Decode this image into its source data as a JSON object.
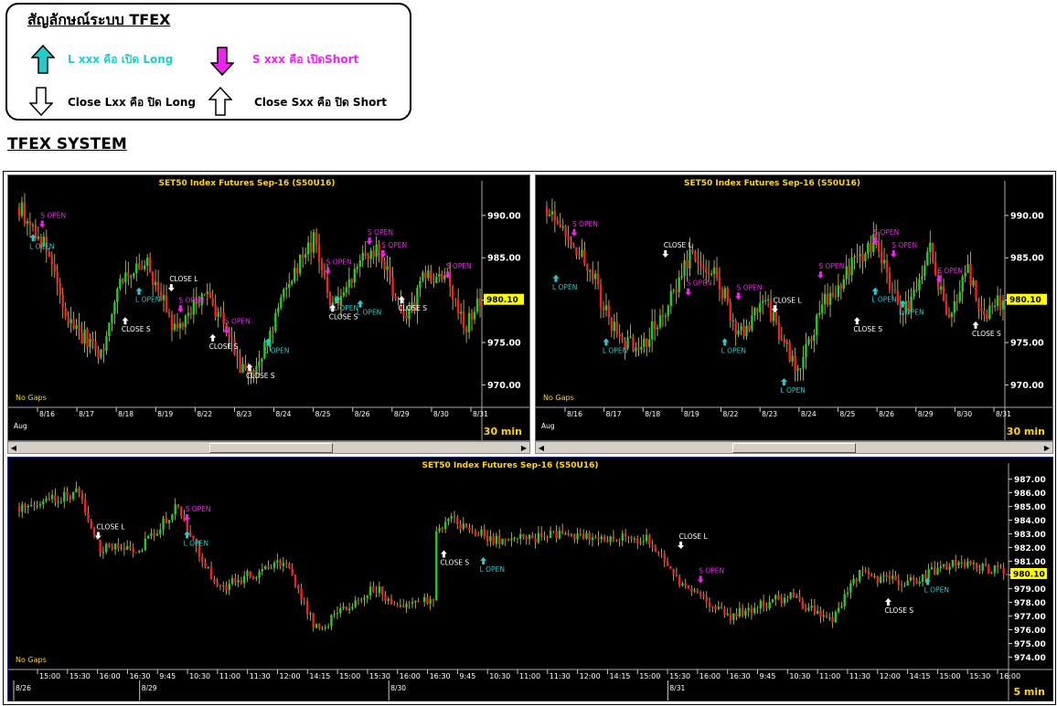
{
  "legend": {
    "title": "สัญลักษณ์ระบบ TFEX",
    "long_open": "L xxx คือ เปิด Long",
    "short_open": "S xxx คือ เปิดShort",
    "close_long": "Close Lxx คือ ปิด Long",
    "close_short": "Close Sxx คือ ปิด Short"
  },
  "system_title": "TFEX SYSTEM",
  "colors": {
    "up": "#22cc22",
    "down": "#ee2222",
    "long": "#22cccc",
    "short": "#ee22ee",
    "close": "#ffffff",
    "title": "#ffd700",
    "price_box": "#ffff00"
  },
  "charts": [
    {
      "title": "SET50  Index  Futures  Sep-16  (S50U16)",
      "timeframe": "30  min",
      "no_gaps": "No  Gaps",
      "last_price": "980.10",
      "y_ticks": [
        "990.00",
        "985.00",
        "980.00",
        "975.00",
        "970.00"
      ],
      "x_ticks": [
        "8/16",
        "8/17",
        "8/18",
        "8/19",
        "8/22",
        "8/23",
        "8/24",
        "8/25",
        "8/26",
        "8/29",
        "8/30",
        "8/31"
      ],
      "x_sub": "Aug",
      "ylim": [
        968,
        993
      ],
      "signals": [
        {
          "label": "S  OPEN",
          "type": "short"
        },
        {
          "label": "L  OPEN",
          "type": "long"
        },
        {
          "label": "CLOSE  L",
          "type": "close_long"
        },
        {
          "label": "L  OPEN",
          "type": "long"
        },
        {
          "label": "CLOSE  S",
          "type": "close_short"
        },
        {
          "label": "S  OPEN",
          "type": "short"
        },
        {
          "label": "CLOSE  S",
          "type": "close_short"
        },
        {
          "label": "S  OPEN",
          "type": "short"
        },
        {
          "label": "CLOSE  S",
          "type": "close_short"
        },
        {
          "label": "L  OPEN",
          "type": "long"
        },
        {
          "label": "S  OPEN",
          "type": "short"
        },
        {
          "label": "L  OPEN",
          "type": "long"
        },
        {
          "label": "CLOSE  S",
          "type": "close_short"
        },
        {
          "label": "S  OPEN",
          "type": "short"
        },
        {
          "label": "S  OPEN",
          "type": "short"
        },
        {
          "label": "L  OPEN",
          "type": "long"
        },
        {
          "label": "CLOSE  S",
          "type": "close_short"
        },
        {
          "label": "S  OPEN",
          "type": "short"
        }
      ]
    },
    {
      "title": "SET50  Index  Futures  Sep-16  (S50U16)",
      "timeframe": "30  min",
      "no_gaps": "No  Gaps",
      "last_price": "980.10",
      "y_ticks": [
        "990.00",
        "985.00",
        "980.00",
        "975.00",
        "970.00"
      ],
      "x_ticks": [
        "8/16",
        "8/17",
        "8/18",
        "8/19",
        "8/22",
        "8/23",
        "8/24",
        "8/25",
        "8/26",
        "8/29",
        "8/30",
        "8/31"
      ],
      "x_sub": "Aug",
      "ylim": [
        968,
        993
      ],
      "signals": [
        {
          "label": "S  OPEN",
          "type": "short"
        },
        {
          "label": "L  OPEN",
          "type": "long"
        },
        {
          "label": "L  OPEN",
          "type": "long"
        },
        {
          "label": "CLOSE  L",
          "type": "close_long"
        },
        {
          "label": "S  OPEN",
          "type": "short"
        },
        {
          "label": "L  OPEN",
          "type": "long"
        },
        {
          "label": "S  OPEN",
          "type": "short"
        },
        {
          "label": "L  OPEN",
          "type": "long"
        },
        {
          "label": "CLOSE  L",
          "type": "close_long"
        },
        {
          "label": "S  OPEN",
          "type": "short"
        },
        {
          "label": "CLOSE  S",
          "type": "close_short"
        },
        {
          "label": "S  OPEN",
          "type": "short"
        },
        {
          "label": "S  OPEN",
          "type": "short"
        },
        {
          "label": "L  OPEN",
          "type": "long"
        },
        {
          "label": "L  OPEN",
          "type": "long"
        },
        {
          "label": "S  OPEN",
          "type": "short"
        },
        {
          "label": "CLOSE  S",
          "type": "close_short"
        }
      ]
    },
    {
      "title": "SET50  Index  Futures  Sep-16  (S50U16)",
      "timeframe": "5  min",
      "no_gaps": "No  Gaps",
      "last_price": "980.10",
      "y_ticks": [
        "987.00",
        "986.00",
        "985.00",
        "984.00",
        "983.00",
        "982.00",
        "981.00",
        "980.00",
        "979.00",
        "978.00",
        "977.00",
        "976.00",
        "975.00",
        "974.00"
      ],
      "x_ticks": [
        "15:00",
        "15:30",
        "16:00",
        "16:30",
        "9:45",
        "10:30",
        "11:00",
        "11:30",
        "12:00",
        "14:15",
        "15:00",
        "15:30",
        "16:00",
        "16:30",
        "9:45",
        "10:30",
        "11:00",
        "11:30",
        "12:00",
        "14:15",
        "15:00",
        "15:30",
        "16:00",
        "16:30",
        "9:45",
        "10:30",
        "11:00",
        "11:30",
        "12:00",
        "14:15",
        "15:00",
        "15:30",
        "16:00"
      ],
      "x_sub": [
        "8/26",
        "8/29",
        "8/30",
        "8/31"
      ],
      "ylim": [
        973.5,
        987.5
      ],
      "signals": [
        {
          "label": "CLOSE  L",
          "type": "close_long"
        },
        {
          "label": "S  OPEN",
          "type": "short"
        },
        {
          "label": "L  OPEN",
          "type": "long"
        },
        {
          "label": "L  OPEN",
          "type": "long"
        },
        {
          "label": "CLOSE  S",
          "type": "close_short"
        },
        {
          "label": "CLOSE  L",
          "type": "close_long"
        },
        {
          "label": "S  OPEN",
          "type": "short"
        },
        {
          "label": "L  OPEN",
          "type": "long"
        },
        {
          "label": "CLOSE  S",
          "type": "close_short"
        }
      ]
    }
  ]
}
